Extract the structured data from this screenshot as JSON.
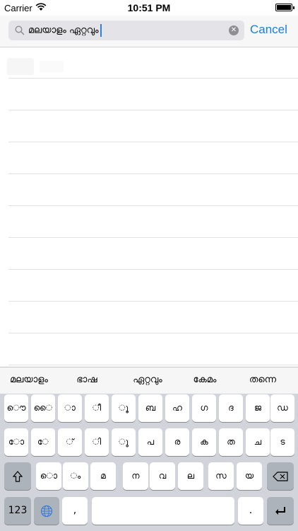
{
  "status_bar": {
    "carrier": "Carrier",
    "time": "10:51 PM"
  },
  "search": {
    "query": "മലയാളം ഏറ്റവും",
    "cancel_label": "Cancel"
  },
  "suggestions": [
    "മലയാളം",
    "ഭാഷ",
    "ഏറ്റവും",
    "കേമം",
    "തന്നെ"
  ],
  "keyboard": {
    "row1": [
      "ൌ",
      "ൈ",
      "ാ",
      "ീ",
      "ൂ",
      "ബ",
      "ഹ",
      "ഗ",
      "ദ",
      "ജ",
      "ഡ"
    ],
    "row2": [
      "ോ",
      "േ",
      "്",
      "ി",
      "ു",
      "പ",
      "ര",
      "ക",
      "ത",
      "ച",
      "ട"
    ],
    "row3": [
      "ൊ",
      "ം",
      "മ",
      "ന",
      "വ",
      "ല",
      "സ",
      "യ"
    ],
    "numbers_label": "123",
    "comma_label": ",",
    "period_label": "."
  },
  "colors": {
    "accent": "#1a7fe0",
    "keyboard_bg": "#d1d4da",
    "dark_key": "#acb3bb"
  }
}
